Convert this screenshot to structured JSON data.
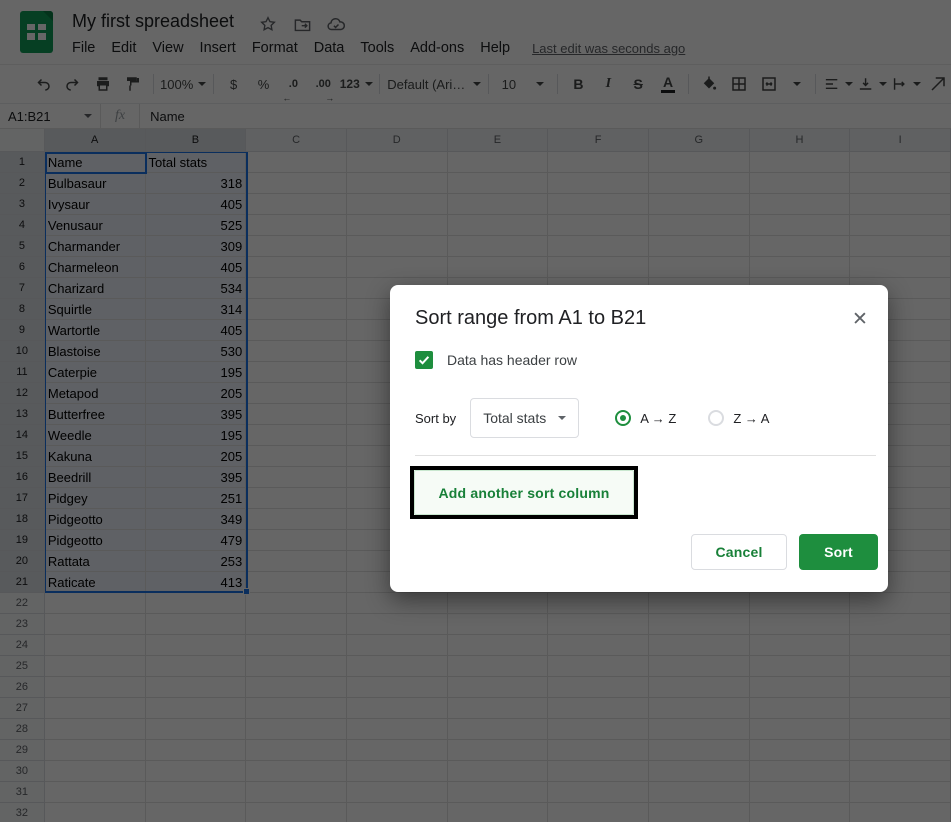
{
  "app": {
    "title": "My first spreadsheet",
    "menu_items": [
      "File",
      "Edit",
      "View",
      "Insert",
      "Format",
      "Data",
      "Tools",
      "Add-ons",
      "Help"
    ],
    "last_edit": "Last edit was seconds ago"
  },
  "toolbar": {
    "zoom": "100%",
    "currency": "$",
    "percent": "%",
    "decrease_decimal": ".0",
    "increase_decimal": ".00",
    "more_formats": "123",
    "font_family": "Default (Ari…",
    "font_size": "10",
    "bold": "B",
    "italic": "I",
    "strikethrough": "S",
    "text_color": "A"
  },
  "formula_bar": {
    "name_box": "A1:B21",
    "fx": "fx",
    "content": "Name"
  },
  "grid": {
    "columns": [
      "A",
      "B",
      "C",
      "D",
      "E",
      "F",
      "G",
      "H",
      "I"
    ],
    "selected_columns": [
      "A",
      "B"
    ],
    "row_count": 32,
    "selected_rows_end": 21,
    "active_cell": "A1",
    "selection_range": "A1:B21",
    "cells": [
      [
        "Name",
        "Total stats"
      ],
      [
        "Bulbasaur",
        "318"
      ],
      [
        "Ivysaur",
        "405"
      ],
      [
        "Venusaur",
        "525"
      ],
      [
        "Charmander",
        "309"
      ],
      [
        "Charmeleon",
        "405"
      ],
      [
        "Charizard",
        "534"
      ],
      [
        "Squirtle",
        "314"
      ],
      [
        "Wartortle",
        "405"
      ],
      [
        "Blastoise",
        "530"
      ],
      [
        "Caterpie",
        "195"
      ],
      [
        "Metapod",
        "205"
      ],
      [
        "Butterfree",
        "395"
      ],
      [
        "Weedle",
        "195"
      ],
      [
        "Kakuna",
        "205"
      ],
      [
        "Beedrill",
        "395"
      ],
      [
        "Pidgey",
        "251"
      ],
      [
        "Pidgeotto",
        "349"
      ],
      [
        "Pidgeotto",
        "479"
      ],
      [
        "Rattata",
        "253"
      ],
      [
        "Raticate",
        "413"
      ]
    ]
  },
  "dialog": {
    "title": "Sort range from A1 to B21",
    "close": "✕",
    "header_checkbox_label": "Data has header row",
    "checkbox_checked": true,
    "sort_by_label": "Sort by",
    "sort_column": "Total stats",
    "order_options": [
      {
        "label": "A → Z",
        "selected": true
      },
      {
        "label": "Z → A",
        "selected": false
      }
    ],
    "add_column_label": "Add another sort column",
    "cancel_label": "Cancel",
    "sort_label": "Sort"
  },
  "colors": {
    "accent_blue": "#1a73e8",
    "sheets_green": "#0f9d58",
    "dialog_green": "#1e8e3e",
    "green_text": "#188038",
    "overlay": "rgba(0,0,0,0.60)"
  }
}
